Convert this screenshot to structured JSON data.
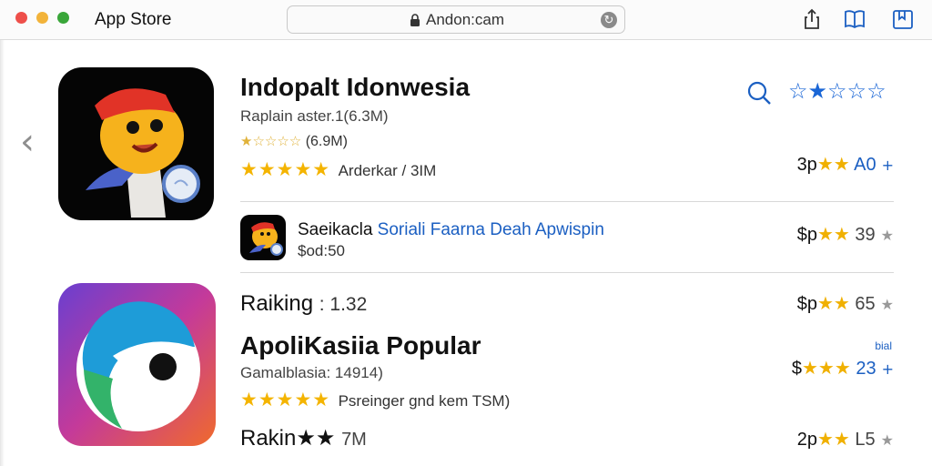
{
  "window": {
    "title": "App Store",
    "traffic_lights": [
      "#ee4f4a",
      "#f2b33a",
      "#3aa63a"
    ],
    "url": "Andon:cam",
    "accent": "#1b5fc2",
    "star_color": "#f4b400"
  },
  "toolbar": {
    "icons": [
      "share-icon",
      "book-icon",
      "bookmark-icon"
    ]
  },
  "featured": {
    "title": "Indopalt Idonwesia",
    "subtitle": "Raplain aster.1(6.3M)",
    "rating_small_stars": "★☆☆☆☆",
    "rating_small_text": "(6.9M)",
    "rating_stars": "★★★★★",
    "rating_text": "Arderkar / 3IM",
    "search_icon": "search-icon",
    "top_stars": "☆★☆☆☆",
    "price_prefix": "3p",
    "price_stars": "★★",
    "price_value": "A0",
    "price_action": "+"
  },
  "list_item": {
    "title": "Saeikacla",
    "title_blue": "Soriali Faarna Deah Apwispin",
    "subtitle": "$od:50",
    "price_prefix": "$p",
    "price_stars": "★★",
    "price_value": "39",
    "price_action": "★"
  },
  "ranking": {
    "label": "Raiking",
    "value": ": 1.32",
    "price_prefix": "$p",
    "price_stars": "★★",
    "price_value": "65",
    "price_action": "★"
  },
  "popular": {
    "title": "ApoliKasiia Popular",
    "subtitle": "Gamalblasia: 14914)",
    "rating_stars": "★★★★★",
    "rating_text": "Psreinger gnd kem TSM)",
    "badge": "bial",
    "price_prefix": "$",
    "price_stars": "★★★",
    "price_value": "23",
    "price_action": "+"
  },
  "bottom_row": {
    "label": "Rakin★★",
    "value": "7M",
    "price_prefix": "2p",
    "price_stars": "★★",
    "price_value": "L5",
    "price_action": "★"
  },
  "nav": {
    "back_glyph": "‹"
  }
}
